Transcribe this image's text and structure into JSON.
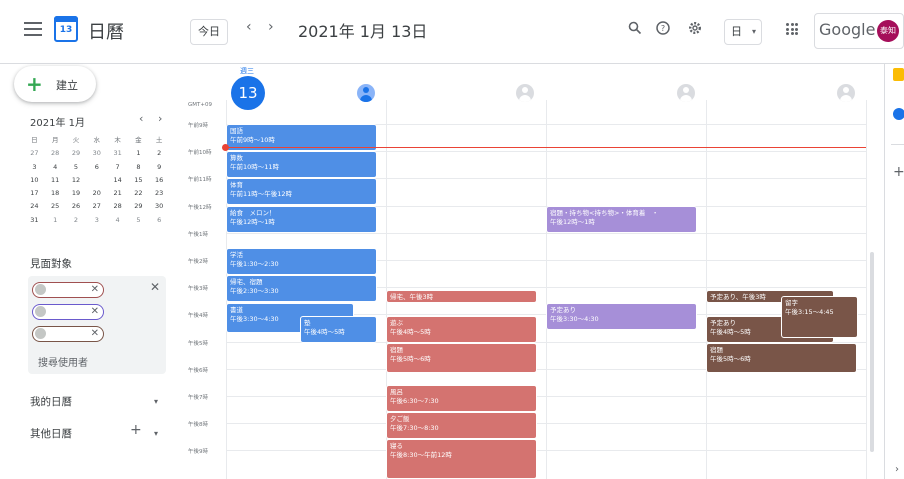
{
  "header": {
    "app_title": "日曆",
    "logo_day": "13",
    "today_label": "今日",
    "prev_label": "‹",
    "next_label": "›",
    "date_title": "2021年 1月 13日",
    "view_label": "日",
    "google_label": "Google",
    "avatar_label": "泰知"
  },
  "sidebar": {
    "create_label": "建立",
    "mini_cal": {
      "title": "2021年 1月",
      "weekdays": [
        "日",
        "月",
        "火",
        "水",
        "木",
        "金",
        "土"
      ],
      "weeks": [
        [
          "27",
          "28",
          "29",
          "30",
          "31",
          "1",
          "2"
        ],
        [
          "3",
          "4",
          "5",
          "6",
          "7",
          "8",
          "9"
        ],
        [
          "10",
          "11",
          "12",
          "13",
          "14",
          "15",
          "16"
        ],
        [
          "17",
          "18",
          "19",
          "20",
          "21",
          "22",
          "23"
        ],
        [
          "24",
          "25",
          "26",
          "27",
          "28",
          "29",
          "30"
        ],
        [
          "31",
          "1",
          "2",
          "3",
          "4",
          "5",
          "6"
        ]
      ],
      "selected": "13"
    },
    "meet_title": "見面對象",
    "search_users": "搜尋使用者",
    "my_calendars": "我的日曆",
    "other_calendars": "其他日曆"
  },
  "day": {
    "weekday": "週三",
    "daynum": "13",
    "gmt": "GMT+09",
    "hours": [
      "午前9時",
      "午前10時",
      "午前11時",
      "午後12時",
      "午後1時",
      "午後2時",
      "午後3時",
      "午後4時",
      "午後5時",
      "午後6時",
      "午後7時",
      "午後8時",
      "午後9時"
    ]
  },
  "events": {
    "e1": {
      "title": "国語",
      "time": "午前9時～10時"
    },
    "e2": {
      "title": "算数",
      "time": "午前10時～11時"
    },
    "e3": {
      "title": "体育",
      "time": "午前11時～午後12時"
    },
    "e4": {
      "title": "給食　メロン！",
      "time": "午後12時～1時"
    },
    "e5": {
      "title": "学活",
      "time": "午後1:30～2:30"
    },
    "e6": {
      "title": "帰宅、宿題",
      "time": "午後2:30～3:30"
    },
    "e7": {
      "title": "書道",
      "time": "午後3:30～4:30"
    },
    "e8": {
      "title": "塾",
      "time": "午後4時～5時"
    },
    "e9": {
      "title": "帰宅、午後3時",
      "time": ""
    },
    "e10": {
      "title": "遊ぶ",
      "time": "午後4時～5時"
    },
    "e11": {
      "title": "宿題",
      "time": "午後5時～6時"
    },
    "e12": {
      "title": "風呂",
      "time": "午後6:30～7:30"
    },
    "e13": {
      "title": "夕ご飯",
      "time": "午後7:30～8:30"
    },
    "e14": {
      "title": "寝る",
      "time": "午後8:30～午前12時"
    },
    "e15": {
      "title": "宿題・持ち物<持ち物>・体育着　・",
      "time": "午後12時～1時"
    },
    "e16": {
      "title": "予定あり",
      "time": "午後3:30～4:30"
    },
    "e17": {
      "title": "予定あり、午後3時",
      "time": ""
    },
    "e18": {
      "title": "予定あり",
      "time": "午後4時～5時"
    },
    "e19": {
      "title": "留字",
      "time": "午後3:15～4:45"
    },
    "e20": {
      "title": "宿題",
      "time": "午後5時～6時"
    }
  },
  "colors": {
    "blue": "#4f8fe6",
    "red": "#d47370",
    "purple": "#a68fd8",
    "brown": "#795548",
    "accent": "#1a73e8",
    "now": "#ea4335"
  }
}
